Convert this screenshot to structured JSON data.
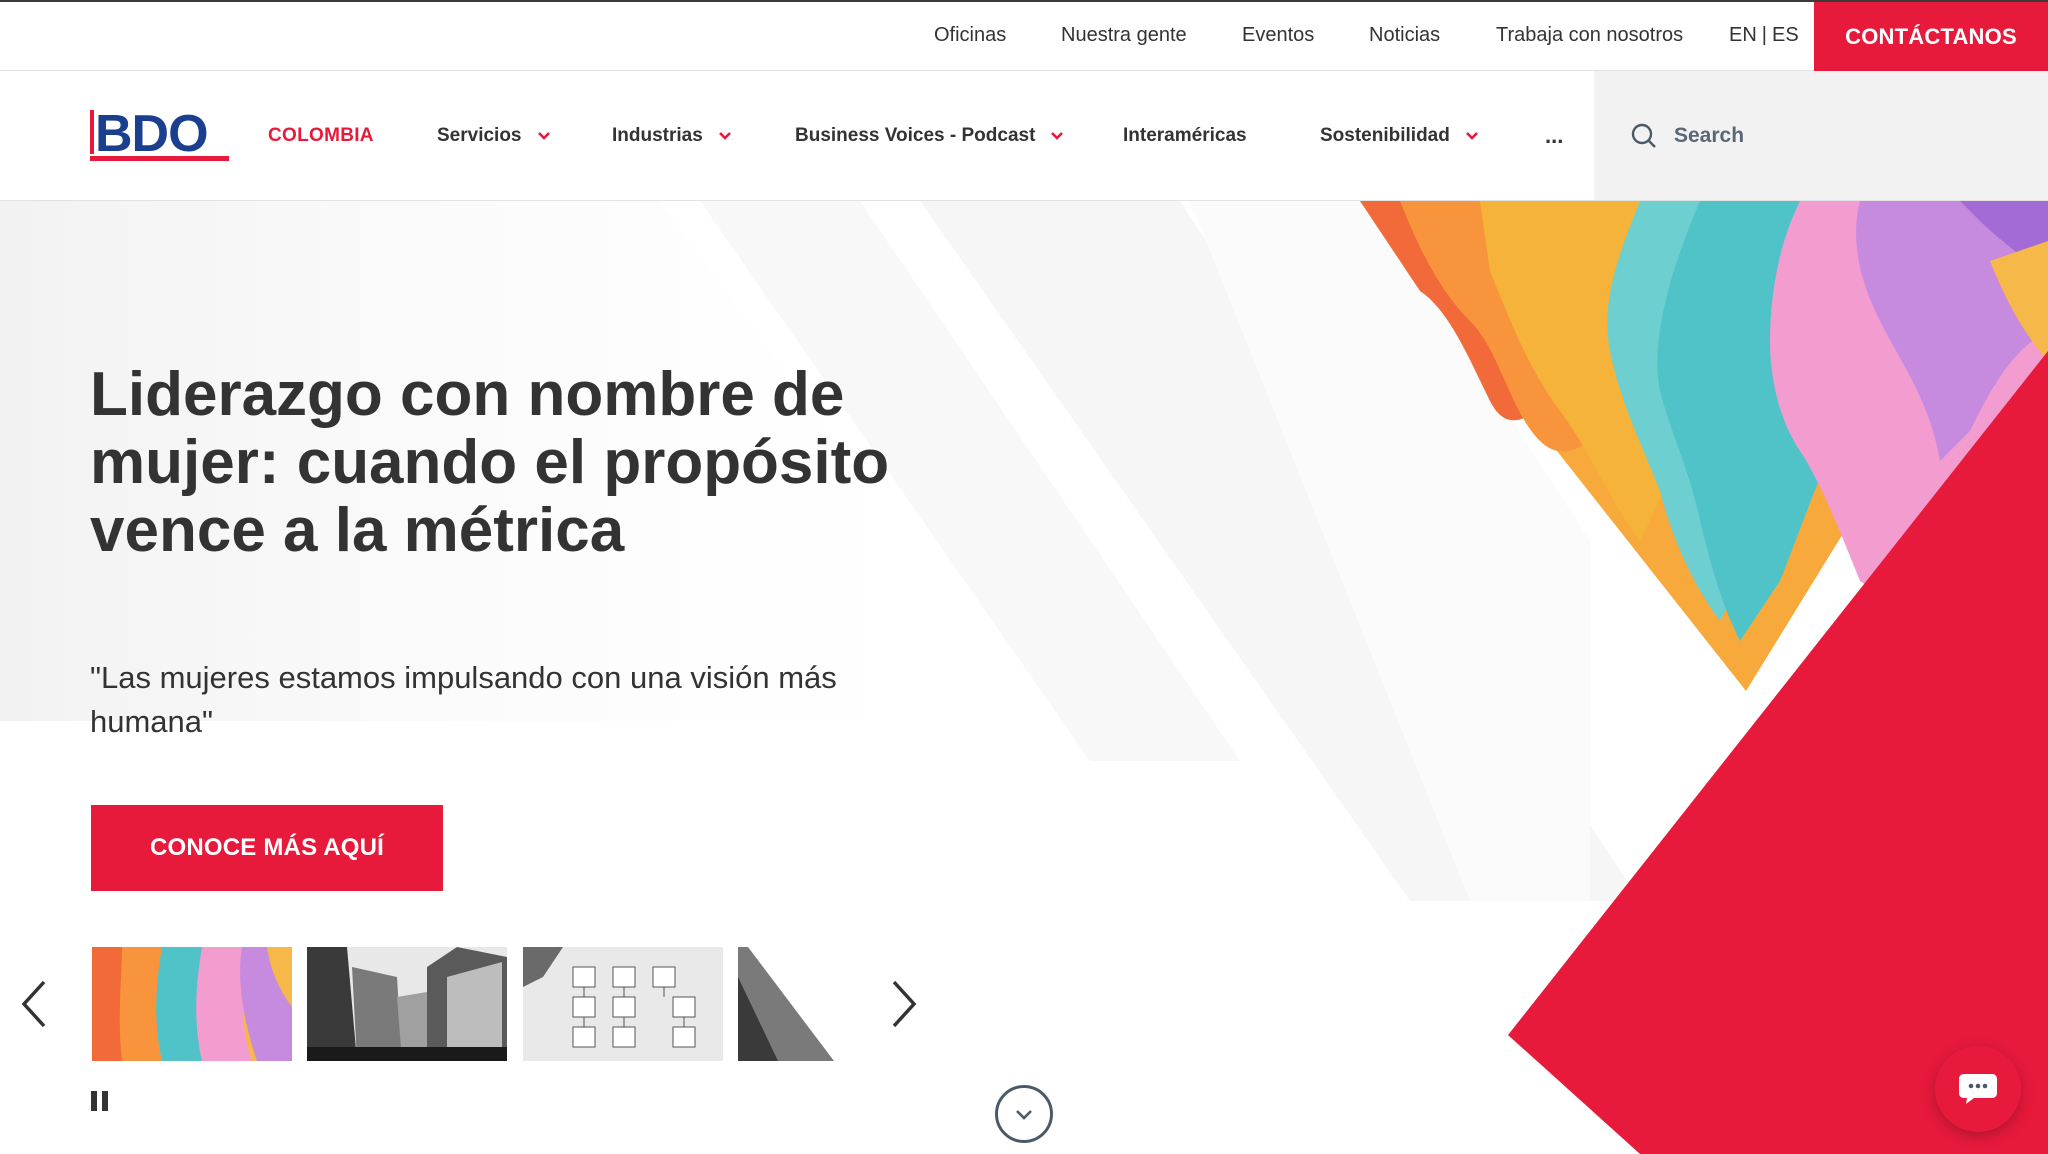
{
  "utility_nav": {
    "links": [
      "Oficinas",
      "Nuestra gente",
      "Eventos",
      "Noticias",
      "Trabaja con nosotros"
    ],
    "lang_en": "EN",
    "lang_es": "ES",
    "lang_separator": "|",
    "contact_label": "CONTÁCTANOS"
  },
  "main_nav": {
    "logo_text": "BDO",
    "country": "COLOMBIA",
    "items": [
      {
        "label": "Servicios",
        "dropdown": true
      },
      {
        "label": "Industrias",
        "dropdown": true
      },
      {
        "label": "Business Voices - Podcast",
        "dropdown": true
      },
      {
        "label": "Interaméricas",
        "dropdown": false
      },
      {
        "label": "Sostenibilidad",
        "dropdown": true
      }
    ],
    "more_label": "...",
    "search_placeholder": "Search"
  },
  "hero": {
    "title": "Liderazgo con nombre de mujer: cuando el propósito vence a la métrica",
    "subtitle": "\"Las mujeres estamos impulsando con una visión más humana\"",
    "cta_label": "CONOCE MÁS AQUÍ"
  },
  "carousel": {
    "thumbnails": [
      "paper-cut-women-profiles",
      "city-skyscrapers-bw",
      "org-chart-bw",
      "laptop-bw"
    ]
  },
  "colors": {
    "brand_red": "#e81a3b",
    "logo_blue": "#1a3f8f",
    "text_dark": "#333333",
    "search_bg": "#f2f2f2"
  }
}
